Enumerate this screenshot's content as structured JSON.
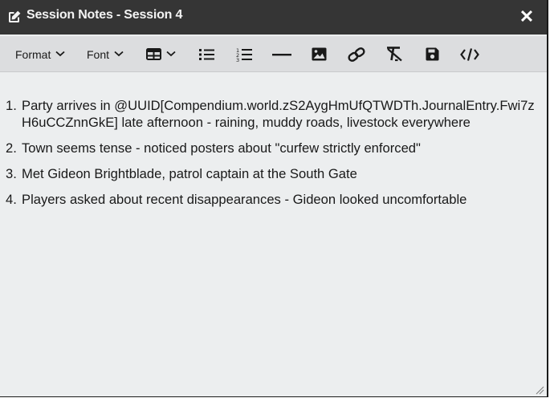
{
  "window": {
    "title": "Session Notes - Session 4",
    "close_label": "✕"
  },
  "toolbar": {
    "format_label": "Format",
    "font_label": "Font",
    "buttons": [
      "table-icon",
      "bullet-list-icon",
      "numbered-list-icon",
      "horizontal-rule-icon",
      "image-icon",
      "link-icon",
      "clear-formatting-icon",
      "save-icon",
      "source-code-icon"
    ]
  },
  "notes": [
    {
      "num": "1.",
      "text": "Party arrives in @UUID[Compendium.world.zS2AygHmUfQTWDTh.JournalEntry.Fwi7zH6uCCZnnGkE] late afternoon - raining, muddy roads, livestock everywhere"
    },
    {
      "num": "2.",
      "text": "Town seems tense - noticed posters about \"curfew strictly enforced\""
    },
    {
      "num": "3.",
      "text": "Met Gideon Brightblade, patrol captain at the South Gate"
    },
    {
      "num": "4.",
      "text": "Players asked about recent disappearances - Gideon looked uncomfortable"
    }
  ]
}
